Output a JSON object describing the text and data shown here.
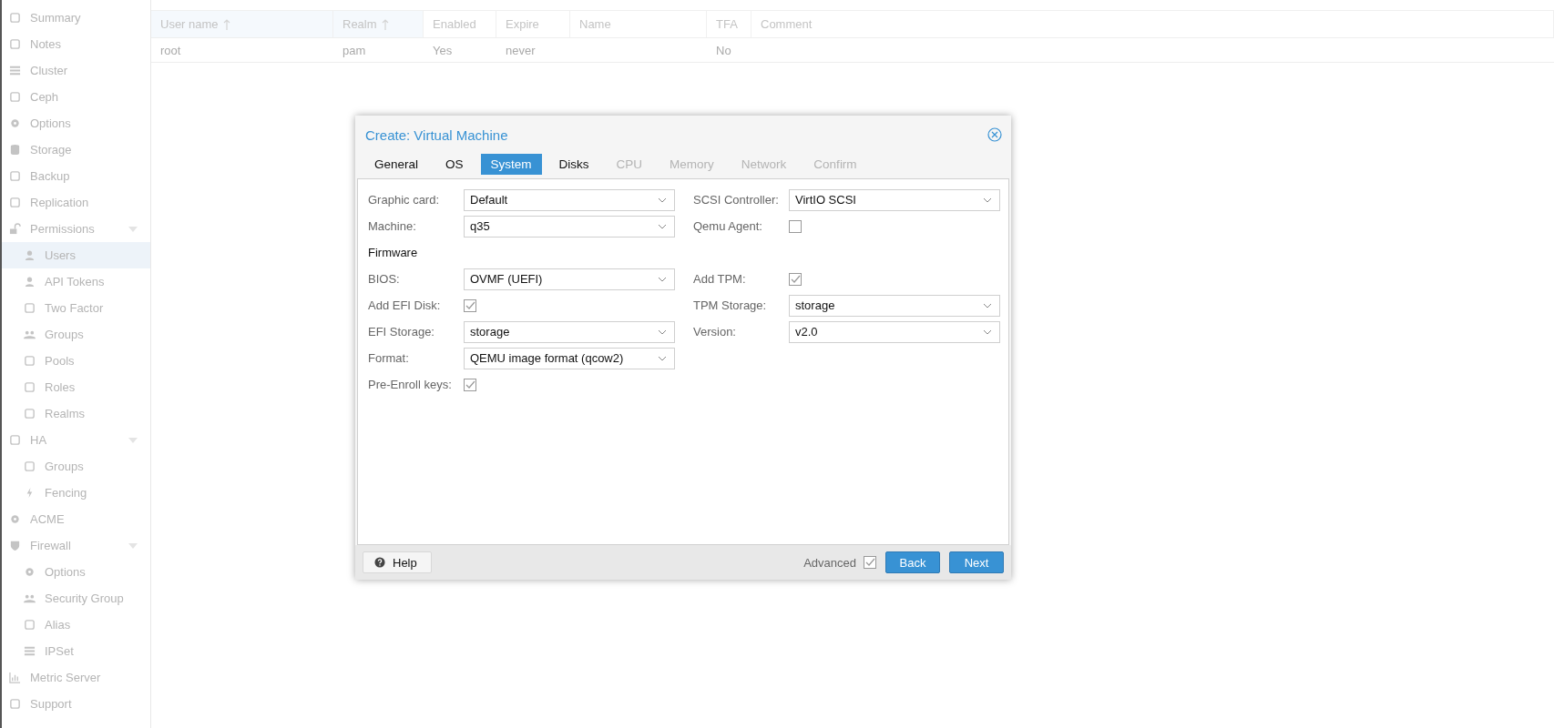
{
  "sidebar": {
    "items": [
      {
        "label": "Summary",
        "selected": false
      },
      {
        "label": "Notes",
        "selected": false
      },
      {
        "label": "Cluster",
        "selected": false
      },
      {
        "label": "Ceph",
        "selected": false
      },
      {
        "label": "Options",
        "selected": false
      },
      {
        "label": "Storage",
        "selected": false
      },
      {
        "label": "Backup",
        "selected": false
      },
      {
        "label": "Replication",
        "selected": false
      },
      {
        "label": "Permissions",
        "selected": false,
        "expanded": true,
        "children": [
          {
            "label": "Users",
            "selected": true
          },
          {
            "label": "API Tokens",
            "selected": false
          },
          {
            "label": "Two Factor",
            "selected": false
          },
          {
            "label": "Groups",
            "selected": false
          },
          {
            "label": "Pools",
            "selected": false
          },
          {
            "label": "Roles",
            "selected": false
          },
          {
            "label": "Realms",
            "selected": false
          }
        ]
      },
      {
        "label": "HA",
        "selected": false,
        "expanded": true,
        "children": [
          {
            "label": "Groups",
            "selected": false
          },
          {
            "label": "Fencing",
            "selected": false
          }
        ]
      },
      {
        "label": "ACME",
        "selected": false
      },
      {
        "label": "Firewall",
        "selected": false,
        "expanded": true,
        "children": [
          {
            "label": "Options",
            "selected": false
          },
          {
            "label": "Security Group",
            "selected": false
          },
          {
            "label": "Alias",
            "selected": false
          },
          {
            "label": "IPSet",
            "selected": false
          }
        ]
      },
      {
        "label": "Metric Server",
        "selected": false
      },
      {
        "label": "Support",
        "selected": false
      }
    ]
  },
  "table": {
    "columns": [
      {
        "label": "User name",
        "sorted": true
      },
      {
        "label": "Realm",
        "sorted": true
      },
      {
        "label": "Enabled",
        "sorted": false
      },
      {
        "label": "Expire",
        "sorted": false
      },
      {
        "label": "Name",
        "sorted": false
      },
      {
        "label": "TFA",
        "sorted": false
      },
      {
        "label": "Comment",
        "sorted": false
      }
    ],
    "rows": [
      [
        "root",
        "pam",
        "Yes",
        "never",
        "",
        "No",
        ""
      ]
    ]
  },
  "dialog": {
    "title": "Create: Virtual Machine",
    "tabs": [
      {
        "label": "General",
        "selected": false,
        "disabled": false
      },
      {
        "label": "OS",
        "selected": false,
        "disabled": false
      },
      {
        "label": "System",
        "selected": true,
        "disabled": false
      },
      {
        "label": "Disks",
        "selected": false,
        "disabled": false
      },
      {
        "label": "CPU",
        "selected": false,
        "disabled": true
      },
      {
        "label": "Memory",
        "selected": false,
        "disabled": true
      },
      {
        "label": "Network",
        "selected": false,
        "disabled": true
      },
      {
        "label": "Confirm",
        "selected": false,
        "disabled": true
      }
    ],
    "left_fields": [
      {
        "kind": "combo",
        "label": "Graphic card:",
        "value": "Default"
      },
      {
        "kind": "combo",
        "label": "Machine:",
        "value": "q35"
      },
      {
        "kind": "heading",
        "label": "Firmware"
      },
      {
        "kind": "combo",
        "label": "BIOS:",
        "value": "OVMF (UEFI)"
      },
      {
        "kind": "checkbox",
        "label": "Add EFI Disk:",
        "checked": true
      },
      {
        "kind": "combo",
        "label": "EFI Storage:",
        "value": "storage"
      },
      {
        "kind": "combo",
        "label": "Format:",
        "value": "QEMU image format (qcow2)"
      },
      {
        "kind": "checkbox",
        "label": "Pre-Enroll keys:",
        "checked": true
      }
    ],
    "right_fields": [
      {
        "kind": "combo",
        "label": "SCSI Controller:",
        "value": "VirtIO SCSI"
      },
      {
        "kind": "checkbox",
        "label": "Qemu Agent:",
        "checked": false
      },
      {
        "kind": "spacer"
      },
      {
        "kind": "checkbox",
        "label": "Add TPM:",
        "checked": true
      },
      {
        "kind": "combo",
        "label": "TPM Storage:",
        "value": "storage"
      },
      {
        "kind": "combo",
        "label": "Version:",
        "value": "v2.0"
      }
    ],
    "footer": {
      "help": "Help",
      "advanced": {
        "label": "Advanced",
        "checked": true
      },
      "buttons": [
        "Back",
        "Next"
      ]
    }
  }
}
